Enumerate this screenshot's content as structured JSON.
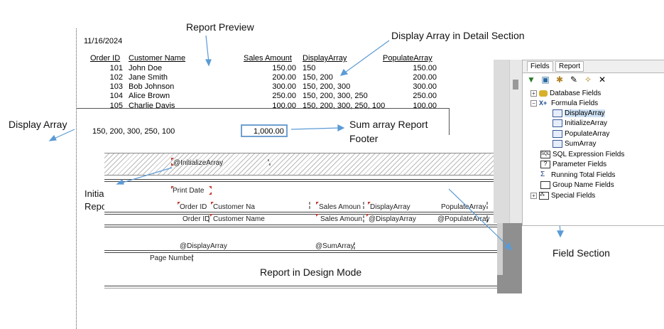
{
  "callouts": {
    "report_preview": "Report Preview",
    "display_array_detail": "Display Array in Detail Section",
    "display_array": "Display Array",
    "sum_array_line1": "Sum array Report",
    "sum_array_line2": "Footer",
    "initialize_line1": "Initialize Array",
    "initialize_line2": "Report Header",
    "field_section": "Field Section",
    "design_mode": "Report in Design Mode"
  },
  "preview": {
    "date": "11/16/2024",
    "headers": {
      "order_id": "Order ID",
      "customer_name": "Customer Name",
      "sales_amount": "Sales Amount",
      "display_array": "DisplayArray",
      "populate_array": "PopulateArray"
    },
    "rows": [
      {
        "id": "101",
        "name": "John Doe",
        "sales": "150.00",
        "display": "150",
        "populate": "150.00"
      },
      {
        "id": "102",
        "name": "Jane Smith",
        "sales": "200.00",
        "display": "150, 200",
        "populate": "200.00"
      },
      {
        "id": "103",
        "name": "Bob Johnson",
        "sales": "300.00",
        "display": "150, 200, 300",
        "populate": "300.00"
      },
      {
        "id": "104",
        "name": "Alice Brown",
        "sales": "250.00",
        "display": "150, 200, 300, 250",
        "populate": "250.00"
      },
      {
        "id": "105",
        "name": "Charlie Davis",
        "sales": "100.00",
        "display": "150, 200, 300, 250, 100",
        "populate": "100.00"
      }
    ],
    "footer_array": "150, 200, 300, 250, 100",
    "footer_sum": "1,000.00"
  },
  "design": {
    "initialize_field": "@InitializeArray",
    "print_date": "Print Date",
    "hdr_order": "Order ID",
    "hdr_customer": "Customer Na",
    "hdr_sales": "Sales Amoun",
    "hdr_display": "DisplayArray",
    "hdr_populate": "PopulateArray",
    "det_order": "Order ID",
    "det_customer": "Customer Name",
    "det_sales": "Sales Amoun",
    "det_display": "@DisplayArray",
    "det_populate": "@PopulateArray",
    "ftr_display": "@DisplayArray",
    "ftr_sum": "@SumArray",
    "page_number": "Page Number"
  },
  "field_explorer": {
    "tabs": [
      "Fields",
      "Report"
    ],
    "toolbar_icons": [
      "insert-field-icon",
      "browse-icon",
      "new-icon",
      "edit-icon",
      "rename-icon",
      "delete-icon"
    ],
    "tree": {
      "database_fields": "Database Fields",
      "formula_fields": "Formula Fields",
      "formulas": [
        "DisplayArray",
        "InitializeArray",
        "PopulateArray",
        "SumArray"
      ],
      "sql_expression": "SQL Expression Fields",
      "parameter": "Parameter Fields",
      "running_total": "Running Total Fields",
      "group_name": "Group Name Fields",
      "special": "Special Fields"
    }
  },
  "colors": {
    "arrow": "#5b9bd5",
    "selection": "#6fa0d0",
    "marker": "#c0392b"
  }
}
